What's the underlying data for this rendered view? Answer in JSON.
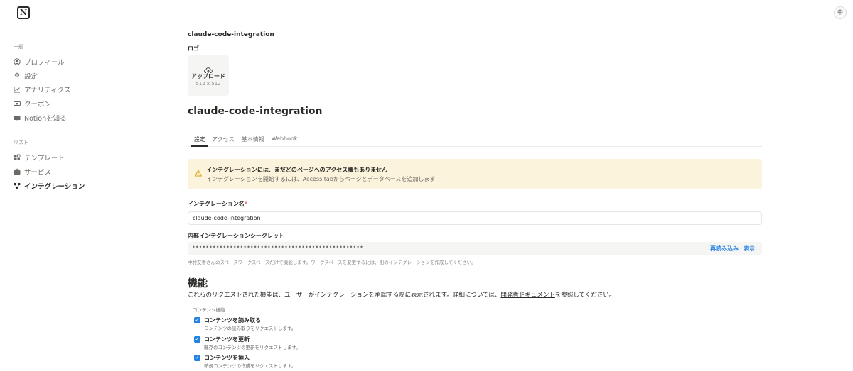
{
  "app": {
    "logo_letter": "N",
    "lang_button": "中"
  },
  "sidebar": {
    "sections": [
      {
        "title": "一般",
        "items": [
          {
            "label": "プロフィール",
            "icon": "profile-icon"
          },
          {
            "label": "設定",
            "icon": "gear-icon"
          },
          {
            "label": "アナリティクス",
            "icon": "analytics-icon"
          },
          {
            "label": "クーポン",
            "icon": "coupon-icon"
          },
          {
            "label": "Notionを知る",
            "icon": "book-icon"
          }
        ]
      },
      {
        "title": "リスト",
        "items": [
          {
            "label": "テンプレート",
            "icon": "template-icon"
          },
          {
            "label": "サービス",
            "icon": "briefcase-icon"
          },
          {
            "label": "インテグレーション",
            "icon": "integration-icon",
            "active": true
          }
        ]
      }
    ]
  },
  "header": {
    "integration_name_small": "claude-code-integration",
    "logo_label": "ロゴ"
  },
  "upload": {
    "label": "アップロード",
    "size": "512 x 512"
  },
  "title": "claude-code-integration",
  "tabs": [
    "設定",
    "アクセス",
    "基本情報",
    "Webhook"
  ],
  "banner": {
    "title": "インテグレーションには、まだどのページへのアクセス権もありません",
    "desc_before": "インテグレーションを開始するには、",
    "desc_link": "Access tab",
    "desc_after": "からページとデータベースを追加します"
  },
  "name_field": {
    "label": "インテグレーション名",
    "required_mark": "*",
    "value": "claude-code-integration"
  },
  "secret_field": {
    "label": "内部インテグレーションシークレット",
    "masked_value": "••••••••••••••••••••••••••••••••••••••••••••••••••",
    "reload_label": "再読み込み",
    "show_label": "表示"
  },
  "hint": {
    "before": "中村友香さんのスペースワークスペースだけで機能します。ワークスペースを変更するには、",
    "link": "別のインテグレーションを作成してください",
    "after": "。"
  },
  "capabilities": {
    "title": "機能",
    "desc_before": "これらのリクエストされた機能は、ユーザーがインテグレーションを承認する際に表示されます。詳細については、",
    "desc_link": "開発者ドキュメント",
    "desc_after": "を参照してください。",
    "content_caption": "コンテンツ機能",
    "items": [
      {
        "label": "コンテンツを読み取る",
        "desc": "コンテンツの読み取りをリクエストします。",
        "checked": true
      },
      {
        "label": "コンテンツを更新",
        "desc": "既存のコンテンツの更新をリクエストします。",
        "checked": true
      },
      {
        "label": "コンテンツを挿入",
        "desc": "新規コンテンツの作成をリクエストします。",
        "checked": true
      }
    ]
  },
  "colors": {
    "accent": "#2383e2",
    "banner_bg": "#fbf3db",
    "warning": "#d9a516",
    "required": "#eb5757"
  }
}
